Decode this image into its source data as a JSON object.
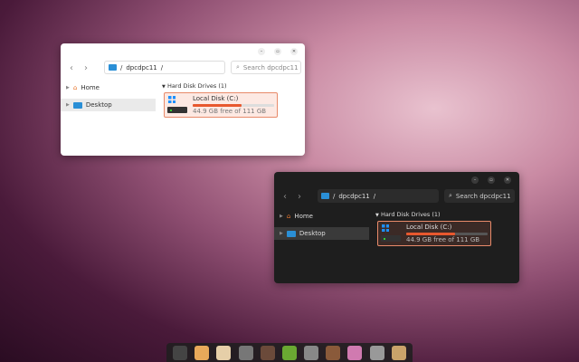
{
  "windows": [
    {
      "theme": "light",
      "path_host": "dpcdpc11",
      "path_sep": "/",
      "search_placeholder": "Search dpcdpc11",
      "sidebar": [
        {
          "label": "Home"
        },
        {
          "label": "Desktop"
        }
      ],
      "group": "Hard Disk Drives (1)",
      "drive": {
        "name": "Local Disk (C:)",
        "free": "44.9 GB free of 111 GB",
        "used_fraction": 0.6
      }
    },
    {
      "theme": "dark",
      "path_host": "dpcdpc11",
      "path_sep": "/",
      "search_placeholder": "Search dpcdpc11",
      "sidebar": [
        {
          "label": "Home"
        },
        {
          "label": "Desktop"
        }
      ],
      "group": "Hard Disk Drives (1)",
      "drive": {
        "name": "Local Disk (C:)",
        "free": "44.9 GB free of 111 GB",
        "used_fraction": 0.6
      }
    }
  ],
  "dock": [
    {
      "icon": "app-grid-icon",
      "color": "#444"
    },
    {
      "icon": "files-icon",
      "color": "#e8a95a"
    },
    {
      "icon": "calculator-icon",
      "color": "#e6cfa8"
    },
    {
      "icon": "disks-icon",
      "color": "#777"
    },
    {
      "icon": "turntable-icon",
      "color": "#6b4a3a"
    },
    {
      "icon": "maps-icon",
      "color": "#6aa832"
    },
    {
      "icon": "gauge-icon",
      "color": "#888"
    },
    {
      "icon": "music-icon",
      "color": "#8a5a3a"
    },
    {
      "icon": "piano-icon",
      "color": "#d07ab0"
    },
    {
      "icon": "mixer-icon",
      "color": "#999"
    },
    {
      "icon": "tools-icon",
      "color": "#c9a36a"
    }
  ]
}
